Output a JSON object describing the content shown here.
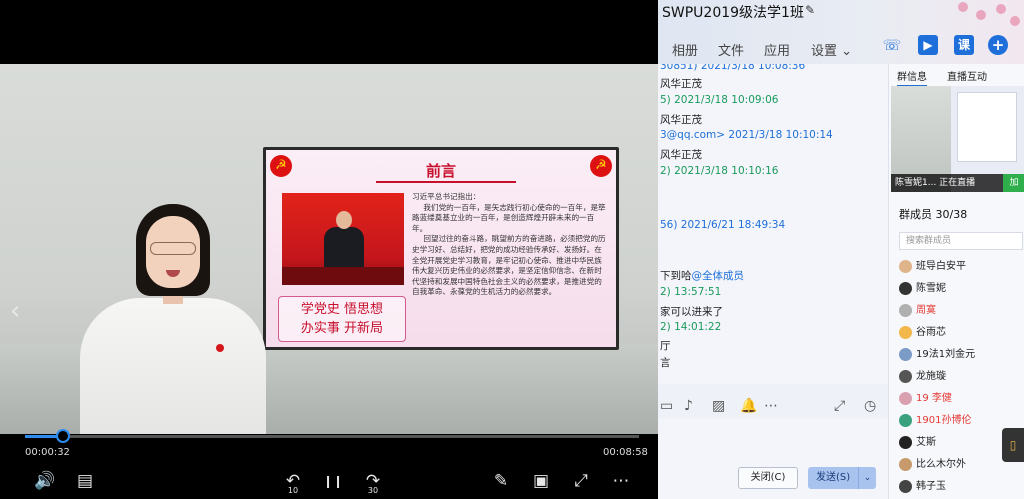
{
  "player": {
    "slide": {
      "title": "前言",
      "slogan_line1": "学党史 悟思想",
      "slogan_line2": "办实事 开新局",
      "paragraphs": [
        "习近平总书记指出：",
        "我们党的一百年，是矢志践行初心使命的一百年，是筚路蓝缕奠基立业的一百年，是创造辉煌开辟未来的一百年。",
        "回望过往的奋斗路，眺望前方的奋进路，必须把党的历史学习好、总结好，把党的成功经验传承好、发扬好。在全党开展党史学习教育，是牢记初心使命、推进中华民族伟大复兴历史伟业的必然要求，是坚定信仰信念、在新时代坚持和发展中国特色社会主义的必然要求，是推进党的自我革命、永葆党的生机活力的必然要求。"
      ]
    },
    "current_time": "00:00:32",
    "duration": "00:08:58",
    "progress": 0.062,
    "rewind_label": "10",
    "forward_label": "30",
    "controls": {
      "volume_icon": "🔊",
      "subtitle_icon": "▤",
      "rewind_icon": "↶",
      "pause_icon": "❙❙",
      "forward_icon": "↷",
      "pen_icon": "✎",
      "pip_icon": "▣",
      "fullscreen_icon": "⤢",
      "more_icon": "⋯",
      "prev_icon": "‹"
    }
  },
  "chat": {
    "title": "SWPU2019级法学1班",
    "tabs": [
      "相册",
      "文件",
      "应用",
      "设置 ⌄"
    ],
    "head_icons": {
      "call": "☏",
      "video": "▶",
      "class": "课",
      "add": "+"
    },
    "messages": [
      {
        "meta": "30851) 2021/3/18 10:08:36",
        "meta_color": "blue"
      },
      {
        "text": "风华正茂"
      },
      {
        "meta": "5) 2021/3/18 10:09:06"
      },
      {
        "text": "风华正茂"
      },
      {
        "meta": "3@qq.com> 2021/3/18 10:10:14",
        "meta_color": "blue"
      },
      {
        "text": "风华正茂"
      },
      {
        "meta": "2) 2021/3/18 10:10:16"
      },
      {
        "meta": "56) 2021/6/21 18:49:34",
        "meta_color": "blue"
      },
      {
        "text": "下到哈",
        "mention": "@全体成员"
      },
      {
        "meta": "2) 13:57:51"
      },
      {
        "text": "家可以进来了"
      },
      {
        "meta": "2) 14:01:22"
      },
      {
        "text": "厅"
      },
      {
        "text": "言"
      }
    ],
    "toolbar": {
      "folder": "▭",
      "image": "▨",
      "bell": "♪",
      "more": "⋯",
      "expand": "⤢",
      "clock": "◷"
    },
    "close_label": "关闭(C)",
    "send_label": "发送(S)",
    "send_arrow": "⌄",
    "panel_tabs": [
      "群信息",
      "直播互动"
    ],
    "live_caption": "陈雪妮1... 正在直播",
    "live_join": "加",
    "members_label": "群成员 30/38",
    "member_search_placeholder": "搜索群成员",
    "members": [
      {
        "name": "班导白安平",
        "color": "#222222",
        "avatar": "#e0b48a"
      },
      {
        "name": "陈雪妮",
        "color": "#222222",
        "avatar": "#333333"
      },
      {
        "name": "周寞",
        "color": "#e53935",
        "avatar": "#b0b0b0"
      },
      {
        "name": "谷雨芯",
        "color": "#222222",
        "avatar": "#f2b84b"
      },
      {
        "name": "19法1刘金元",
        "color": "#222222",
        "avatar": "#7a9cc6"
      },
      {
        "name": "龙施璇",
        "color": "#222222",
        "avatar": "#555555"
      },
      {
        "name": "19 李健",
        "color": "#e53935",
        "avatar": "#d9a0b0"
      },
      {
        "name": "1901孙博伦",
        "color": "#e53935",
        "avatar": "#3aa17e"
      },
      {
        "name": "艾斯",
        "color": "#222222",
        "avatar": "#222222"
      },
      {
        "name": "比么木尔外",
        "color": "#222222",
        "avatar": "#c69a6b"
      },
      {
        "name": "韩子玉",
        "color": "#222222",
        "avatar": "#444444"
      }
    ],
    "side_icon": "▯"
  }
}
